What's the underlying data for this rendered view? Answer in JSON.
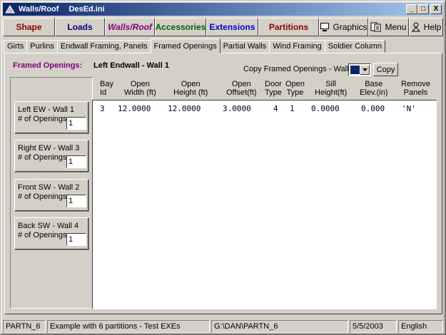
{
  "window": {
    "title": "Walls/Roof",
    "document": "DesEd.ini",
    "minimize": "_",
    "maximize": "□",
    "close": "X"
  },
  "toolbar": {
    "shape": "Shape",
    "loads": "Loads",
    "walls_roof": "Walls/Roof",
    "accessories": "Accessories",
    "extensions": "Extensions",
    "partitions": "Partitions",
    "graphics": "Graphics",
    "menu": "Menu",
    "help": "Help"
  },
  "tabs": [
    "Girts",
    "Purlins",
    "Endwall Framing, Panels",
    "Framed Openings",
    "Partial Walls",
    "Wind Framing",
    "Soldier Column"
  ],
  "active_tab": "Framed Openings",
  "header": {
    "section_label": "Framed Openings:",
    "wall_title": "Left Endwall - Wall 1",
    "copy_label": "Copy Framed Openings - Wall",
    "copy_button": "Copy"
  },
  "walls": [
    {
      "name": "Left EW - Wall 1",
      "openings_label": "# of Openings",
      "openings": "1"
    },
    {
      "name": "Right EW - Wall 3",
      "openings_label": "# of Openings",
      "openings": "1"
    },
    {
      "name": "Front SW - Wall 2",
      "openings_label": "# of Openings",
      "openings": "1"
    },
    {
      "name": "Back SW - Wall 4",
      "openings_label": "# of Openings",
      "openings": "1"
    }
  ],
  "columns": {
    "bay_id": [
      "Bay",
      "Id"
    ],
    "open_width": [
      "Open",
      "Width (ft)"
    ],
    "open_height": [
      "Open",
      "Height (ft)"
    ],
    "open_offset": [
      "Open",
      "Offset(ft)"
    ],
    "door_type": [
      "Door",
      "Type"
    ],
    "open_type": [
      "Open",
      "Type"
    ],
    "sill_height": [
      "Sill",
      "Height(ft)"
    ],
    "base_elev": [
      "Base",
      "Elev.(in)"
    ],
    "remove_panels": [
      "Remove",
      "Panels"
    ]
  },
  "rows": [
    {
      "bay_id": "3",
      "open_width": "12.0000",
      "open_height": "12.0000",
      "open_offset": "3.0000",
      "door_type": "4",
      "open_type": "1",
      "sill_height": "0.0000",
      "base_elev": "0.000",
      "remove_panels": "'N'"
    }
  ],
  "statusbar": {
    "project": "PARTN_6",
    "description": "Example with 6 partitions - Test EXEs",
    "path": "G:\\DAN\\PARTN_6",
    "date": "5/5/2003",
    "language": "English"
  }
}
